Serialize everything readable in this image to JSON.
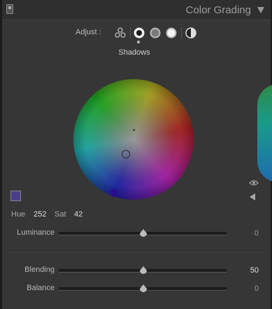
{
  "header": {
    "title": "Color Grading"
  },
  "adjust": {
    "label": "Adjust :",
    "modes": [
      "three-way-icon",
      "shadows-icon",
      "midtones-icon",
      "highlights-icon",
      "global-icon"
    ],
    "selected_mode": "shadows-icon"
  },
  "region": {
    "label": "Shadows"
  },
  "wheel": {
    "hue": 252,
    "saturation": 42
  },
  "hue_sat": {
    "hue_label": "Hue",
    "hue_value": "252",
    "sat_label": "Sat",
    "sat_value": "42"
  },
  "sliders": {
    "luminance": {
      "label": "Luminance",
      "value": "0",
      "position": 0.5
    },
    "blending": {
      "label": "Blending",
      "value": "50",
      "position": 0.5
    },
    "balance": {
      "label": "Balance",
      "value": "0",
      "position": 0.5
    }
  },
  "colors": {
    "swatch": "#4a3e8a",
    "hue_marker": "#2a0e8e"
  }
}
